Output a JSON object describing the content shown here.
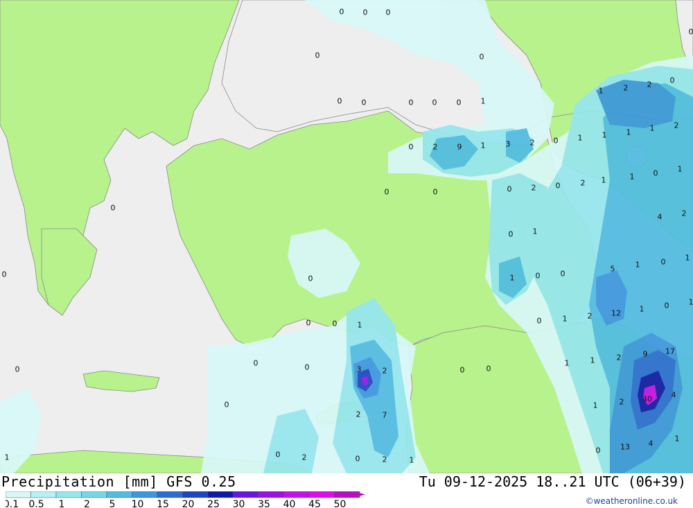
{
  "title": "Precipitation [mm] GFS 0.25",
  "valid_time": "Tu 09-12-2025 18..21 UTC (06+39)",
  "credit": "©weatheronline.co.uk",
  "colors": {
    "sea": "#eeeeee",
    "land": "#b8f28c",
    "border": "#9a9a9a"
  },
  "legend": {
    "labels": [
      "0.1",
      "0.5",
      "1",
      "2",
      "5",
      "10",
      "15",
      "20",
      "25",
      "30",
      "35",
      "40",
      "45",
      "50"
    ],
    "colors": [
      "#d8f8f8",
      "#b8f0f4",
      "#96e6ee",
      "#74d6e8",
      "#50bce2",
      "#3c96dc",
      "#2c6cd2",
      "#1e44c0",
      "#1018a8",
      "#6a14e0",
      "#9a12e6",
      "#c410e8",
      "#e00ce8",
      "#b810c0"
    ]
  },
  "map_values": [
    "0",
    "0",
    "0",
    "0",
    "0",
    "0",
    "0",
    "0",
    "0",
    "1",
    "0",
    "0",
    "1",
    "2",
    "2",
    "0",
    "0",
    "2",
    "9",
    "1",
    "3",
    "2",
    "0",
    "1",
    "1",
    "1",
    "1",
    "1",
    "2",
    "0",
    "0",
    "0",
    "0",
    "2",
    "0",
    "2",
    "1",
    "1",
    "0",
    "1",
    "4",
    "2",
    "0",
    "1",
    "1",
    "0",
    "0",
    "1",
    "5",
    "1",
    "0",
    "1",
    "0",
    "0",
    "1",
    "2",
    "12",
    "1",
    "0",
    "0",
    "0",
    "0",
    "1",
    "3",
    "2",
    "0",
    "0",
    "0",
    "1",
    "2",
    "9",
    "17",
    "0",
    "0",
    "2",
    "7",
    "0",
    "1",
    "2",
    "40",
    "4",
    "1",
    "13",
    "4",
    "0",
    "2",
    "0",
    "2",
    "1",
    "0",
    "1"
  ]
}
